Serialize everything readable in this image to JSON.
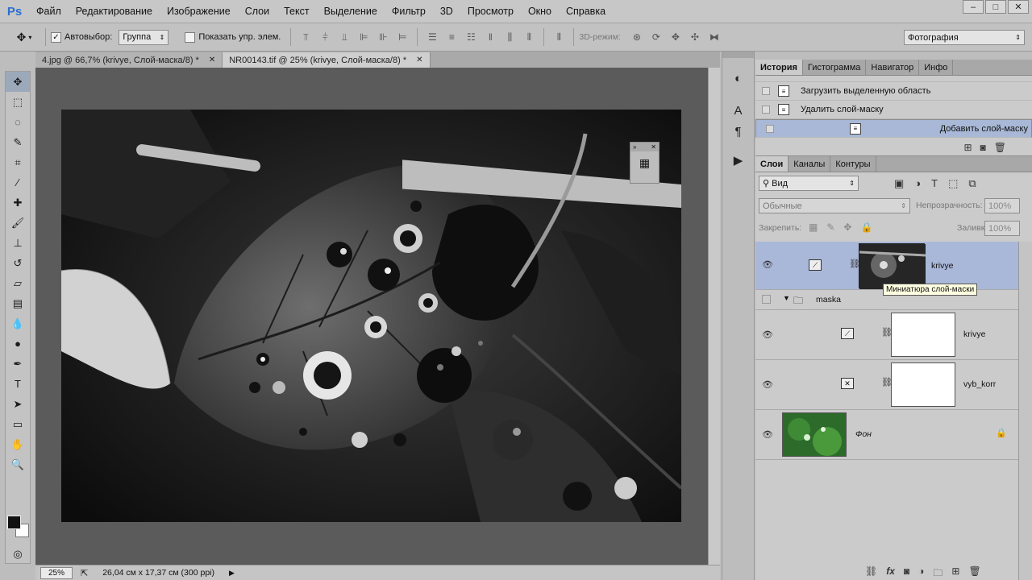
{
  "app": {
    "logo": "Ps"
  },
  "menu": [
    "Файл",
    "Редактирование",
    "Изображение",
    "Слои",
    "Текст",
    "Выделение",
    "Фильтр",
    "3D",
    "Просмотр",
    "Окно",
    "Справка"
  ],
  "window_controls": [
    "–",
    "□",
    "✕"
  ],
  "options": {
    "autoselect_label": "Автовыбор:",
    "autoselect_value": "Группа",
    "show_transform_label": "Показать упр. элем.",
    "mode3d_label": "3D-режим:",
    "workspace": "Фотография"
  },
  "tabs": [
    {
      "label": "4.jpg @ 66,7% (krivye, Слой-маска/8) *",
      "close": "✕"
    },
    {
      "label": "NR00143.tif @ 25% (krivye, Слой-маска/8) *",
      "close": "✕"
    }
  ],
  "status": {
    "zoom": "25%",
    "doc_size": "26,04 см x 17,37 см (300 ppi)"
  },
  "history": {
    "tabs": [
      "История",
      "Гистограмма",
      "Навигатор",
      "Инфо"
    ],
    "items": [
      "Загрузить выделенную область",
      "Удалить слой-маску",
      "Добавить слой-маску"
    ]
  },
  "layers": {
    "tabs": [
      "Слои",
      "Каналы",
      "Контуры"
    ],
    "filter": "Вид",
    "blend_mode": "Обычные",
    "opacity_label": "Непрозрачность:",
    "opacity_value": "100%",
    "lock_label": "Закрепить:",
    "fill_label": "Заливка:",
    "fill_value": "100%",
    "items": [
      {
        "name": "krivye",
        "kind": "curves",
        "selected": true
      },
      {
        "name": "maska",
        "kind": "group"
      },
      {
        "name": "krivye",
        "kind": "curves"
      },
      {
        "name": "vyb_korr",
        "kind": "selective"
      },
      {
        "name": "Фон",
        "kind": "background"
      }
    ],
    "tooltip": "Миниатюра слой-маски"
  }
}
